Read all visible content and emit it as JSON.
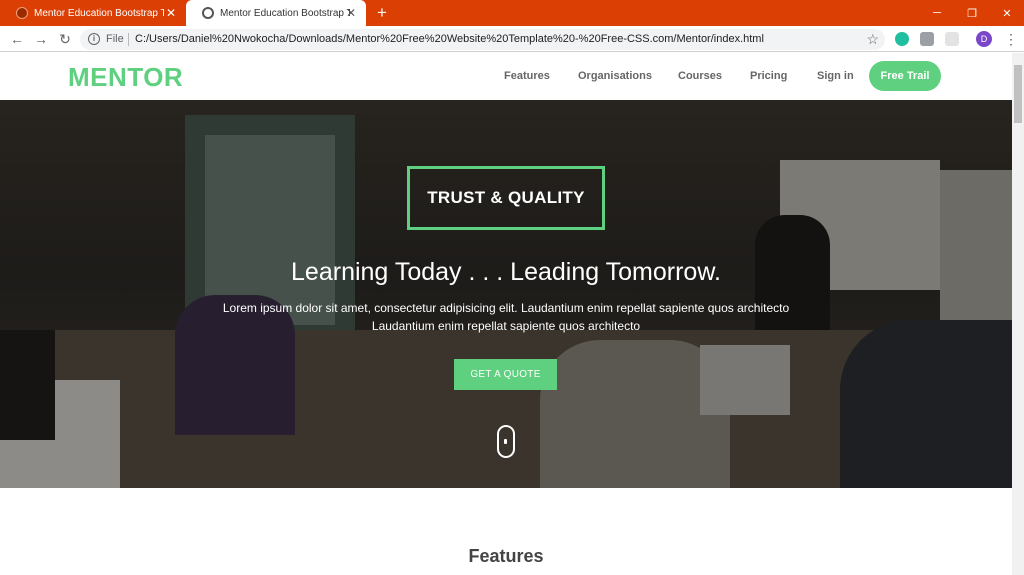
{
  "browser": {
    "tabs": [
      {
        "title": "Mentor Education Bootstrap The",
        "active": false
      },
      {
        "title": "Mentor Education Bootstrap The",
        "active": true
      }
    ],
    "new_tab": "+",
    "window_controls": {
      "minimize": "─",
      "maximize": "❐",
      "close": "✕"
    },
    "nav": {
      "back": "←",
      "forward": "→",
      "reload": "↻"
    },
    "address": {
      "scheme_label": "File",
      "url": "C:/Users/Daniel%20Nwokocha/Downloads/Mentor%20Free%20Website%20Template%20-%20Free-CSS.com/Mentor/index.html",
      "star": "☆"
    },
    "profile_initial": "D",
    "menu": "⋮"
  },
  "site": {
    "logo": "MENTOR",
    "nav_items": [
      "Features",
      "Organisations",
      "Courses",
      "Pricing",
      "Sign in"
    ],
    "cta": "Free Trail",
    "hero": {
      "badge": "TRUST & QUALITY",
      "title": "Learning Today . . . Leading Tomorrow.",
      "text_line1": "Lorem ipsum dolor sit amet, consectetur adipisicing elit. Laudantium enim repellat sapiente quos architecto",
      "text_line2": "Laudantium enim repellat sapiente quos architecto",
      "button": "GET A QUOTE"
    },
    "section_title": "Features"
  },
  "colors": {
    "tabstrip": "#db3f04",
    "brand_green": "#5fcf80"
  }
}
